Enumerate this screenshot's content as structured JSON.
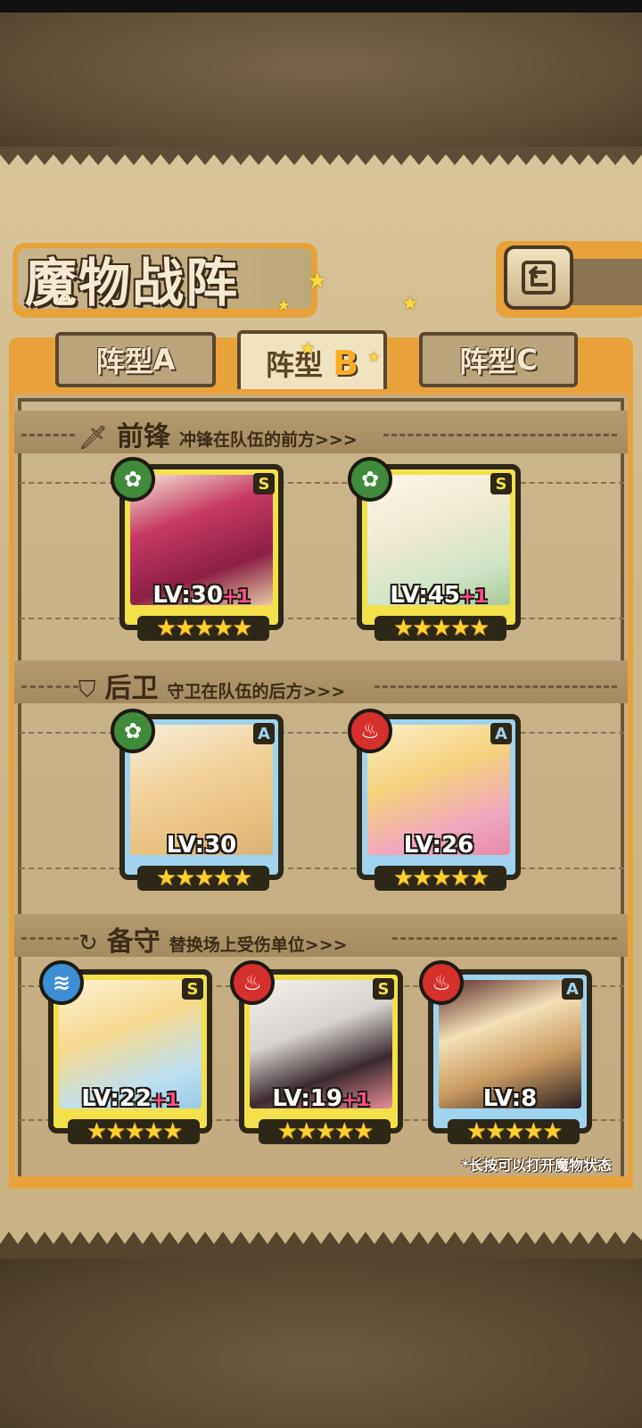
{
  "title": "魔物战阵",
  "tabs": [
    {
      "label": "阵型",
      "letter": "A",
      "active": false
    },
    {
      "label": "阵型",
      "letter": "B",
      "active": true
    },
    {
      "label": "阵型",
      "letter": "C",
      "active": false
    }
  ],
  "sections": {
    "front": {
      "icon": "sword-icon",
      "title": "前锋",
      "subtitle": "冲锋在队伍的前方>>>"
    },
    "back": {
      "icon": "shield-icon",
      "title": "后卫",
      "subtitle": "守卫在队伍的后方>>>"
    },
    "reserve": {
      "icon": "swap-icon",
      "title": "备守",
      "subtitle": "替换场上受伤单位>>>"
    }
  },
  "cards": {
    "front": [
      {
        "grade": "S",
        "element": "leaf",
        "level": "LV:30",
        "plus": "+1",
        "stars": "★★★★★"
      },
      {
        "grade": "S",
        "element": "leaf",
        "level": "LV:45",
        "plus": "+1",
        "stars": "★★★★★"
      }
    ],
    "back": [
      {
        "grade": "A",
        "element": "leaf",
        "level": "LV:30",
        "plus": "",
        "stars": "★★★★★"
      },
      {
        "grade": "A",
        "element": "fire",
        "level": "LV:26",
        "plus": "",
        "stars": "★★★★★"
      }
    ],
    "reserve": [
      {
        "grade": "S",
        "element": "water",
        "level": "LV:22",
        "plus": "+1",
        "stars": "★★★★★"
      },
      {
        "grade": "S",
        "element": "fire",
        "level": "LV:19",
        "plus": "+1",
        "stars": "★★★★★"
      },
      {
        "grade": "A",
        "element": "fire",
        "level": "LV:8",
        "plus": "",
        "stars": "★★★★★"
      }
    ]
  },
  "footnote": "*长按可以打开魔物状态",
  "colors": {
    "accent": "#e9a23b",
    "grade_s": "#f2e14a",
    "grade_a": "#9fd3ee",
    "leaf": "#3f8b3a",
    "fire": "#d6302b",
    "water": "#3c8fd4"
  }
}
